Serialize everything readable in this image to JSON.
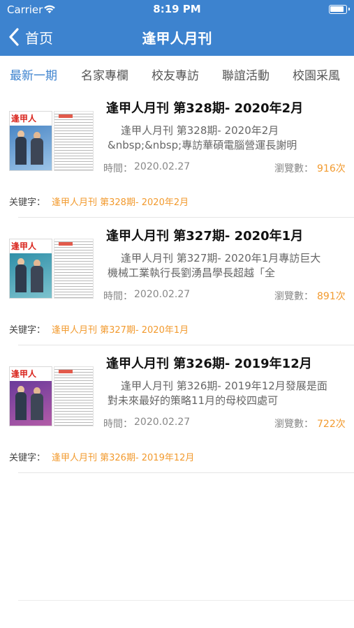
{
  "status_bar": {
    "carrier": "Carrier",
    "time": "8:19 PM"
  },
  "nav": {
    "back_label": "首页",
    "title": "逢甲人月刊"
  },
  "tabs": [
    {
      "label": "最新一期",
      "active": true
    },
    {
      "label": "名家專欄",
      "active": false
    },
    {
      "label": "校友專訪",
      "active": false
    },
    {
      "label": "聯誼活動",
      "active": false
    },
    {
      "label": "校園采風",
      "active": false
    }
  ],
  "labels": {
    "time": "時間：",
    "views": "瀏覽數：",
    "keyword": "关键字："
  },
  "cover_masthead": "逢甲人",
  "articles": [
    {
      "title": "逢甲人月刊 第328期- 2020年2月",
      "summary": "逢甲人月刊 第328期- 2020年2月&nbsp;&nbsp;專訪華碩電腦營運長謝明",
      "time": "2020.02.27",
      "views": "916次",
      "keyword": "逢甲人月刊 第328期- 2020年2月",
      "cover_colors": [
        "#4a86c5",
        "#9fc6e8"
      ]
    },
    {
      "title": "逢甲人月刊 第327期- 2020年1月",
      "summary": "逢甲人月刊 第327期- 2020年1月專訪巨大機械工業執行長劉湧昌學長超越「全",
      "time": "2020.02.27",
      "views": "891次",
      "keyword": "逢甲人月刊 第327期- 2020年1月",
      "cover_colors": [
        "#2f8fa8",
        "#7fc4cf"
      ]
    },
    {
      "title": "逢甲人月刊 第326期- 2019年12月",
      "summary": "逢甲人月刊 第326期- 2019年12月發展是面對未來最好的策略11月的母校四處可",
      "time": "2020.02.27",
      "views": "722次",
      "keyword": "逢甲人月刊 第326期- 2019年12月",
      "cover_colors": [
        "#6a3a9a",
        "#b55da8"
      ]
    }
  ]
}
